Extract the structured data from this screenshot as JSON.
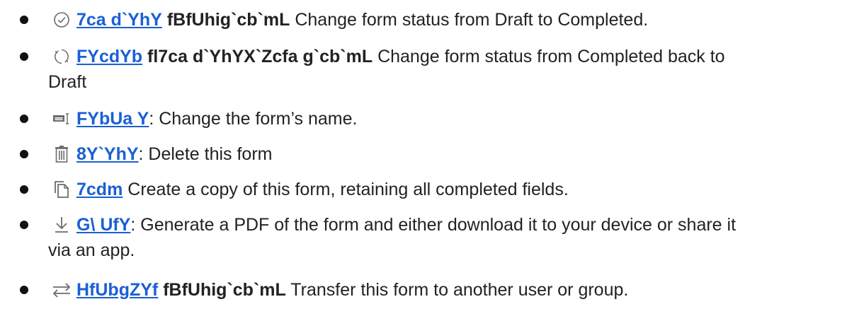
{
  "items": [
    {
      "icon": "check-circle-icon",
      "link": "7ca d`YhY",
      "bold": "fBfUhig`cb`mL",
      "text": " Change form status from Draft to Completed."
    },
    {
      "icon": "circular-arrows-icon",
      "link": "FYcdYb",
      "bold": "fl7ca d`YhYX`Zcfa g`cb`mL",
      "text": " Change form status from Completed back to",
      "continuation": "Draft"
    },
    {
      "icon": "rename-icon",
      "link": "FYbUa Y",
      "bold": "",
      "text": ": Change the form’s name."
    },
    {
      "icon": "trash-icon",
      "link": "8Y`YhY",
      "bold": "",
      "text": ": Delete this form"
    },
    {
      "icon": "copy-icon",
      "link": "7cdm",
      "bold": "",
      "text": " Create a copy of this form, retaining all completed fields."
    },
    {
      "icon": "download-icon",
      "link": "G\\ UfY",
      "bold": "",
      "text": ": Generate a PDF of the form and either download it to your device or share it",
      "continuation": "via an app."
    },
    {
      "icon": "transfer-icon",
      "link": "HfUbgZYf",
      "bold": "fBfUhig`cb`mL",
      "text": " Transfer this form to another user or group."
    }
  ]
}
